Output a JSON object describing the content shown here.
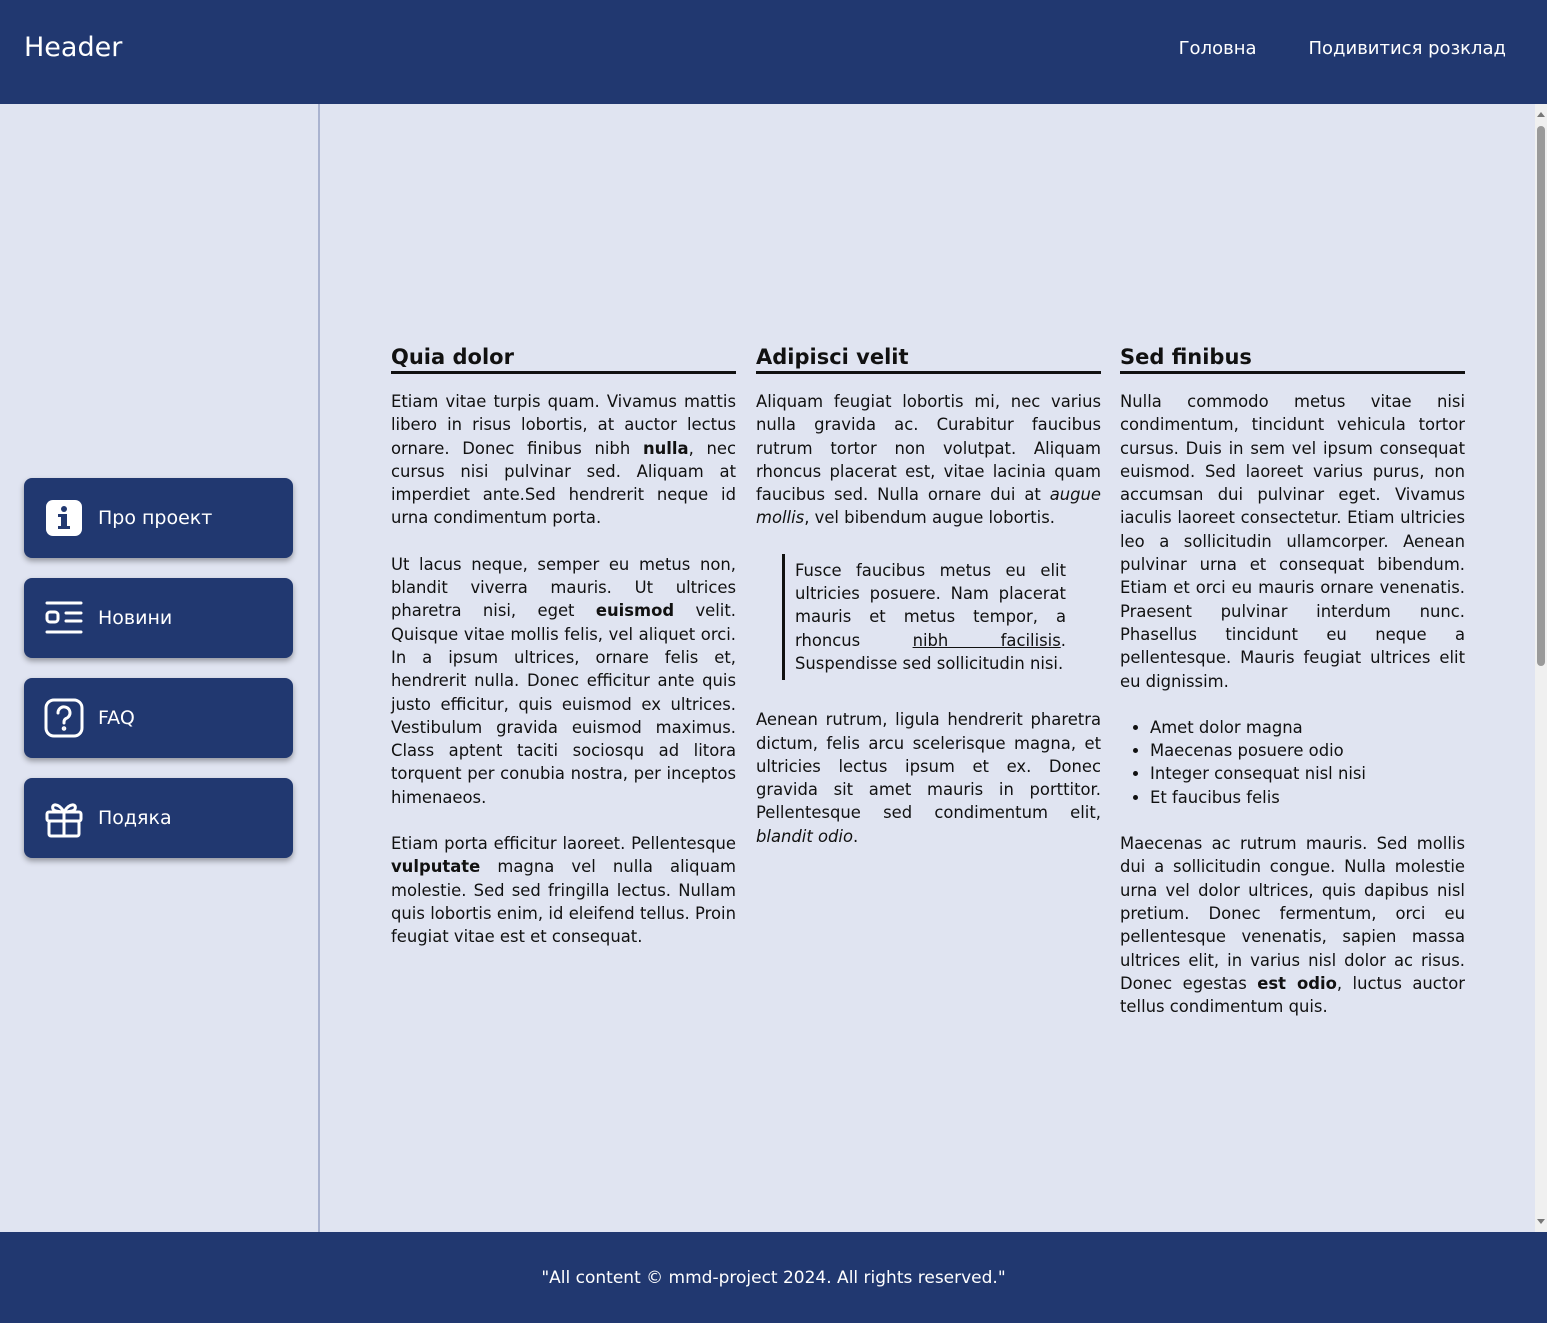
{
  "header": {
    "brand": "Header",
    "nav": [
      "Головна",
      "Подивитися розклад"
    ]
  },
  "sidebar": {
    "items": [
      {
        "label": "Про проект",
        "icon": "info-icon"
      },
      {
        "label": "Новини",
        "icon": "news-icon"
      },
      {
        "label": "FAQ",
        "icon": "question-icon"
      },
      {
        "label": "Подяка",
        "icon": "gift-icon"
      }
    ]
  },
  "articles": {
    "col1": {
      "title": "Quia dolor",
      "p1_a": "Etiam vitae turpis quam. Vivamus mattis libero in risus lobortis, at auctor lectus ornare. Donec finibus nibh ",
      "p1_bold": "nulla",
      "p1_b": ", nec cursus nisi pulvinar sed. Aliquam at imperdiet ante.Sed hendrerit neque id urna condimentum porta.",
      "p2_a": "Ut lacus neque, semper eu metus non, blandit viverra mauris. Ut ultrices pharetra nisi, eget ",
      "p2_bold": "euismod",
      "p2_b": " velit. Quisque vitae mollis felis, vel aliquet orci. In a ipsum ultrices, ornare felis et, hendrerit nulla. Donec efficitur ante quis justo efficitur, quis euismod ex ultrices. Vestibulum gravida euismod maximus. Class aptent taciti sociosqu ad litora torquent per conubia nostra, per inceptos himenaeos.",
      "p3_a": "Etiam porta efficitur laoreet. Pellentesque ",
      "p3_bold": "vulputate",
      "p3_b": " magna vel nulla aliquam molestie. Sed sed fringilla lectus. Nullam quis lobortis enim, id eleifend tellus. Proin feugiat vitae est et consequat."
    },
    "col2": {
      "title": "Adipisci velit",
      "p1_a": "Aliquam feugiat lobortis mi, nec varius nulla gravida ac. Curabitur faucibus rutrum tortor non volutpat. Aliquam rhoncus placerat est, vitae lacinia quam faucibus sed. Nulla ornare dui at ",
      "p1_italic": "augue mollis",
      "p1_b": ", vel bibendum augue lobortis.",
      "quote_a": "Fusce faucibus metus eu elit ultricies posuere. Nam placerat mauris et metus tempor, a rhoncus ",
      "quote_u": "nibh facilisis",
      "quote_b": ". Suspendisse sed sollicitudin nisi.",
      "p2_a": "Aenean rutrum, ligula hendrerit pharetra dictum, felis arcu scelerisque magna, et ultricies lectus ipsum et ex. Donec gravida sit amet mauris in porttitor. Pellentesque sed condimentum elit, ",
      "p2_italic": "blandit odio",
      "p2_b": "."
    },
    "col3": {
      "title": "Sed finibus",
      "p1": "Nulla commodo metus vitae nisi condimentum, tincidunt vehicula tortor cursus. Duis in sem vel ipsum consequat euismod. Sed laoreet varius purus, non accumsan dui pulvinar eget. Vivamus iaculis laoreet consectetur. Etiam ultricies leo a sollicitudin ullamcorper. Aenean pulvinar urna et consequat bibendum. Etiam et orci eu mauris ornare venenatis. Praesent pulvinar interdum nunc. Phasellus tincidunt eu neque a pellentesque. Mauris feugiat ultrices elit eu dignissim.",
      "list": [
        "Amet dolor magna",
        "Maecenas posuere odio",
        "Integer consequat nisl nisi",
        "Et faucibus felis"
      ],
      "p2_a": "Maecenas ac rutrum mauris. Sed mollis dui a sollicitudin congue. Nulla molestie urna vel dolor ultrices, quis dapibus nisl pretium. Donec fermentum, orci eu pellentesque venenatis, sapien massa ultrices elit, in varius nisl dolor ac risus. Donec egestas ",
      "p2_bold": "est odio",
      "p2_b": ", luctus auctor tellus condimentum quis."
    }
  },
  "footer": {
    "text": "\"All content © mmd-project 2024. All rights reserved.\""
  },
  "colors": {
    "primary": "#213870",
    "background": "#e0e4f1"
  }
}
